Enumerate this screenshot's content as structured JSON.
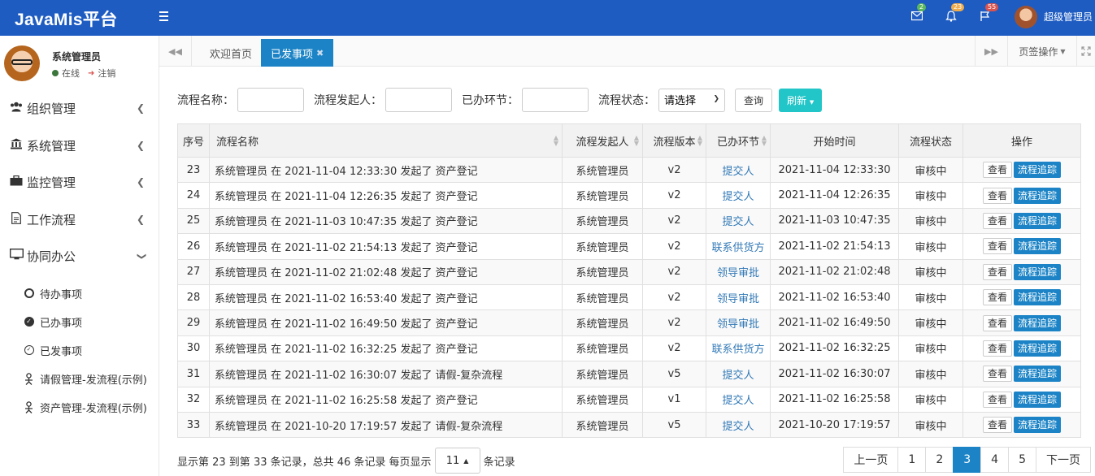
{
  "header": {
    "brand": "JavaMis平台",
    "mail_badge": "2",
    "bell_badge": "23",
    "flag_badge": "55",
    "user_name": "超级管理员"
  },
  "sidebar": {
    "user_name": "系统管理员",
    "status_online": "在线",
    "logout": "注销",
    "menu": [
      {
        "label": "组织管理",
        "icon": "users-icon"
      },
      {
        "label": "系统管理",
        "icon": "bank-icon"
      },
      {
        "label": "监控管理",
        "icon": "briefcase-icon"
      },
      {
        "label": "工作流程",
        "icon": "file-icon"
      },
      {
        "label": "协同办公",
        "icon": "desktop-icon"
      }
    ],
    "submenu": [
      {
        "label": "待办事项",
        "icon": "circle-icon"
      },
      {
        "label": "已办事项",
        "icon": "check-circle-icon"
      },
      {
        "label": "已发事项",
        "icon": "check-circle-outline-icon"
      },
      {
        "label": "请假管理-发流程(示例)",
        "icon": "person-icon"
      },
      {
        "label": "资产管理-发流程(示例)",
        "icon": "person-icon"
      }
    ]
  },
  "tabs": {
    "items": [
      {
        "label": "欢迎首页",
        "active": false
      },
      {
        "label": "已发事项",
        "active": true
      }
    ],
    "page_ops": "页签操作"
  },
  "search": {
    "flow_name_label": "流程名称：",
    "initiator_label": "流程发起人：",
    "node_label": "已办环节：",
    "status_label": "流程状态：",
    "status_selected": "请选择",
    "query_button": "查询",
    "refresh_button": "刷新"
  },
  "table": {
    "headers": [
      "序号",
      "流程名称",
      "流程发起人",
      "流程版本",
      "已办环节",
      "开始时间",
      "流程状态",
      "操作"
    ],
    "view_label": "查看",
    "trace_label": "流程追踪",
    "rows": [
      {
        "seq": "23",
        "name": "系统管理员 在 2021-11-04 12:33:30 发起了 资产登记",
        "initiator": "系统管理员",
        "version": "v2",
        "node": "提交人",
        "start": "2021-11-04 12:33:30",
        "status": "审核中"
      },
      {
        "seq": "24",
        "name": "系统管理员 在 2021-11-04 12:26:35 发起了 资产登记",
        "initiator": "系统管理员",
        "version": "v2",
        "node": "提交人",
        "start": "2021-11-04 12:26:35",
        "status": "审核中"
      },
      {
        "seq": "25",
        "name": "系统管理员 在 2021-11-03 10:47:35 发起了 资产登记",
        "initiator": "系统管理员",
        "version": "v2",
        "node": "提交人",
        "start": "2021-11-03 10:47:35",
        "status": "审核中"
      },
      {
        "seq": "26",
        "name": "系统管理员 在 2021-11-02 21:54:13 发起了 资产登记",
        "initiator": "系统管理员",
        "version": "v2",
        "node": "联系供货方",
        "start": "2021-11-02 21:54:13",
        "status": "审核中"
      },
      {
        "seq": "27",
        "name": "系统管理员 在 2021-11-02 21:02:48 发起了 资产登记",
        "initiator": "系统管理员",
        "version": "v2",
        "node": "领导审批",
        "start": "2021-11-02 21:02:48",
        "status": "审核中"
      },
      {
        "seq": "28",
        "name": "系统管理员 在 2021-11-02 16:53:40 发起了 资产登记",
        "initiator": "系统管理员",
        "version": "v2",
        "node": "领导审批",
        "start": "2021-11-02 16:53:40",
        "status": "审核中"
      },
      {
        "seq": "29",
        "name": "系统管理员 在 2021-11-02 16:49:50 发起了 资产登记",
        "initiator": "系统管理员",
        "version": "v2",
        "node": "领导审批",
        "start": "2021-11-02 16:49:50",
        "status": "审核中"
      },
      {
        "seq": "30",
        "name": "系统管理员 在 2021-11-02 16:32:25 发起了 资产登记",
        "initiator": "系统管理员",
        "version": "v2",
        "node": "联系供货方",
        "start": "2021-11-02 16:32:25",
        "status": "审核中"
      },
      {
        "seq": "31",
        "name": "系统管理员 在 2021-11-02 16:30:07 发起了 请假-复杂流程",
        "initiator": "系统管理员",
        "version": "v5",
        "node": "提交人",
        "start": "2021-11-02 16:30:07",
        "status": "审核中"
      },
      {
        "seq": "32",
        "name": "系统管理员 在 2021-11-02 16:25:58 发起了 资产登记",
        "initiator": "系统管理员",
        "version": "v1",
        "node": "提交人",
        "start": "2021-11-02 16:25:58",
        "status": "审核中"
      },
      {
        "seq": "33",
        "name": "系统管理员 在 2021-10-20 17:19:57 发起了 请假-复杂流程",
        "initiator": "系统管理员",
        "version": "v5",
        "node": "提交人",
        "start": "2021-10-20 17:19:57",
        "status": "审核中"
      }
    ]
  },
  "pager": {
    "info_prefix": "显示第 23 到第 33 条记录，总共 46 条记录 每页显示",
    "page_size": "11",
    "info_suffix": "条记录",
    "prev": "上一页",
    "next": "下一页",
    "pages": [
      "1",
      "2",
      "3",
      "4",
      "5"
    ],
    "current_page": "3"
  }
}
